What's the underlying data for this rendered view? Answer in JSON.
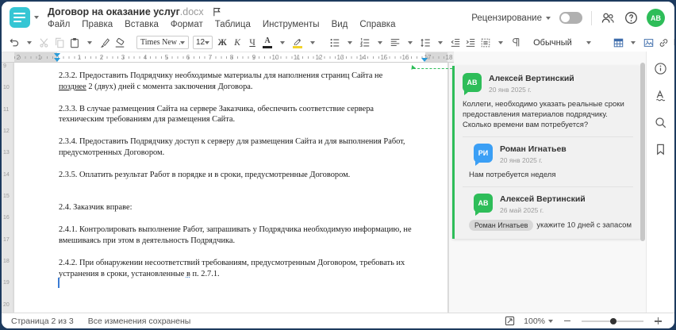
{
  "header": {
    "doc_title": "Договор на оказание услуг",
    "doc_ext": ".docx",
    "menu_items": [
      "Файл",
      "Правка",
      "Вставка",
      "Формат",
      "Таблица",
      "Инструменты",
      "Вид",
      "Справка"
    ],
    "review_label": "Рецензирование",
    "avatar_initials": "АВ"
  },
  "toolbar": {
    "font_name": "Times New ...",
    "font_size": "12",
    "bold_label": "Ж",
    "italic_label": "К",
    "underline_label": "Ч",
    "font_color_label": "А",
    "style_name": "Обычный"
  },
  "ruler": {
    "margin_numbers": [
      "2",
      "1"
    ],
    "numbers": [
      "1",
      "2",
      "3",
      "4",
      "5",
      "6",
      "7",
      "8",
      "9",
      "10",
      "11",
      "12",
      "13",
      "14",
      "15",
      "16",
      "17",
      "18"
    ],
    "v_numbers": [
      "9",
      "10",
      "11",
      "12",
      "13",
      "14",
      "15",
      "16",
      "17",
      "18",
      "19",
      "20"
    ]
  },
  "document": {
    "p1_line1": "2.3.2. Предоставить Подрядчику необходимые материалы для наполнения страниц Сайта не",
    "p1_underlined": "позднее",
    "p1_rest": " 2 (двух) дней с момента заключения Договора.",
    "p2": "2.3.3. В случае размещения Сайта на сервере Заказчика, обеспечить соответствие сервера техническим требованиям для размещения Сайта.",
    "p3": "2.3.4. Предоставить Подрядчику доступ к серверу для размещения Сайта и для выполнения Работ, предусмотренных Договором.",
    "p4": "2.3.5. Оплатить результат Работ в порядке и в сроки, предусмотренные Договором.",
    "p5": "2.4. Заказчик вправе:",
    "p6": "2.4.1. Контролировать выполнение Работ, запрашивать у Подрядчика необходимую информацию, не вмешиваясь при этом в деятельность Подрядчика.",
    "p7_before": "2.4.2. При обнаружении несоответствий требованиям, предусмотренным Договором, требовать их устранения в сроки, установленные ",
    "p7_marked": "в",
    "p7_after": " п. 2.7.1."
  },
  "comments": {
    "thread": [
      {
        "initials": "АВ",
        "name": "Алексей Вертинский",
        "date": "20 янв 2025 г.",
        "text": "Коллеги, необходимо указать реальные сроки предоставления материалов подрядчику. Сколько времени вам потребуется?"
      },
      {
        "initials": "РИ",
        "name": "Роман Игнатьев",
        "date": "20 янв 2025 г.",
        "text": "Нам потребуется неделя"
      },
      {
        "initials": "АВ",
        "name": "Алексей Вертинский",
        "date": "26 май 2025 г.",
        "mention": "Роман Игнатьев",
        "text": "укажите 10 дней с запасом"
      }
    ]
  },
  "status_bar": {
    "page_info": "Страница 2 из 3",
    "save_status": "Все изменения сохранены",
    "zoom_value": "100%"
  },
  "colors": {
    "accent_green": "#2ebd59",
    "avatar_blue": "#3b9ff5",
    "logo_teal": "#35c6d4",
    "marker_blue": "#2b9bd8",
    "frame_navy": "#1d3a5e"
  }
}
